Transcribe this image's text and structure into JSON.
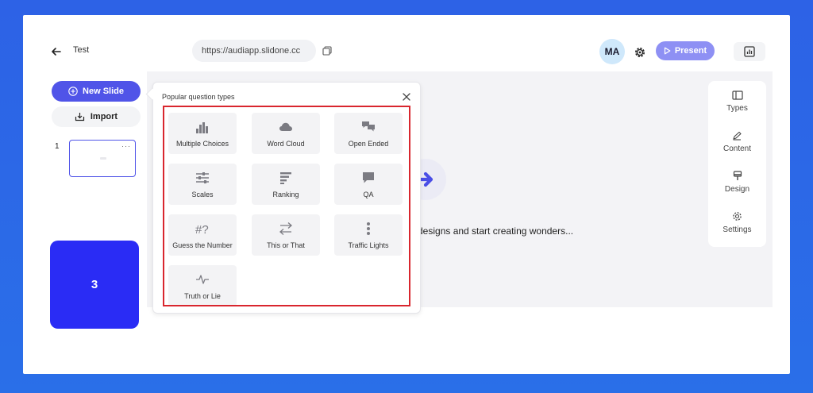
{
  "header": {
    "doc_title": "Test",
    "url": "https://audiapp.slidone.cc",
    "avatar_initials": "MA",
    "present_label": "Present"
  },
  "sidebar": {
    "new_slide_label": "New Slide",
    "import_label": "Import",
    "slide_number": "1",
    "thumb_menu": "···"
  },
  "step_badge": "3",
  "canvas": {
    "text": "designs and start creating wonders..."
  },
  "right_panel": {
    "items": [
      {
        "label": "Types",
        "icon": "types-icon"
      },
      {
        "label": "Content",
        "icon": "pen-icon"
      },
      {
        "label": "Design",
        "icon": "paint-icon"
      },
      {
        "label": "Settings",
        "icon": "gear-icon"
      }
    ]
  },
  "popup": {
    "title": "Popular question types",
    "types": [
      {
        "label": "Multiple Choices",
        "icon": "bar-chart-icon"
      },
      {
        "label": "Word Cloud",
        "icon": "cloud-icon"
      },
      {
        "label": "Open Ended",
        "icon": "chat-bubbles-icon"
      },
      {
        "label": "Scales",
        "icon": "sliders-icon"
      },
      {
        "label": "Ranking",
        "icon": "ranking-lines-icon"
      },
      {
        "label": "QA",
        "icon": "speech-bubble-icon"
      },
      {
        "label": "Guess the Number",
        "icon": "hash-question-icon"
      },
      {
        "label": "This or That",
        "icon": "swap-arrows-icon"
      },
      {
        "label": "Traffic Lights",
        "icon": "traffic-light-icon"
      },
      {
        "label": "Truth or Lie",
        "icon": "pulse-icon"
      }
    ]
  },
  "colors": {
    "background": "#2d62e6",
    "primary": "#5054e8",
    "present": "#8e90f4",
    "badge": "#2a2cf5",
    "highlight": "#d9262e"
  }
}
